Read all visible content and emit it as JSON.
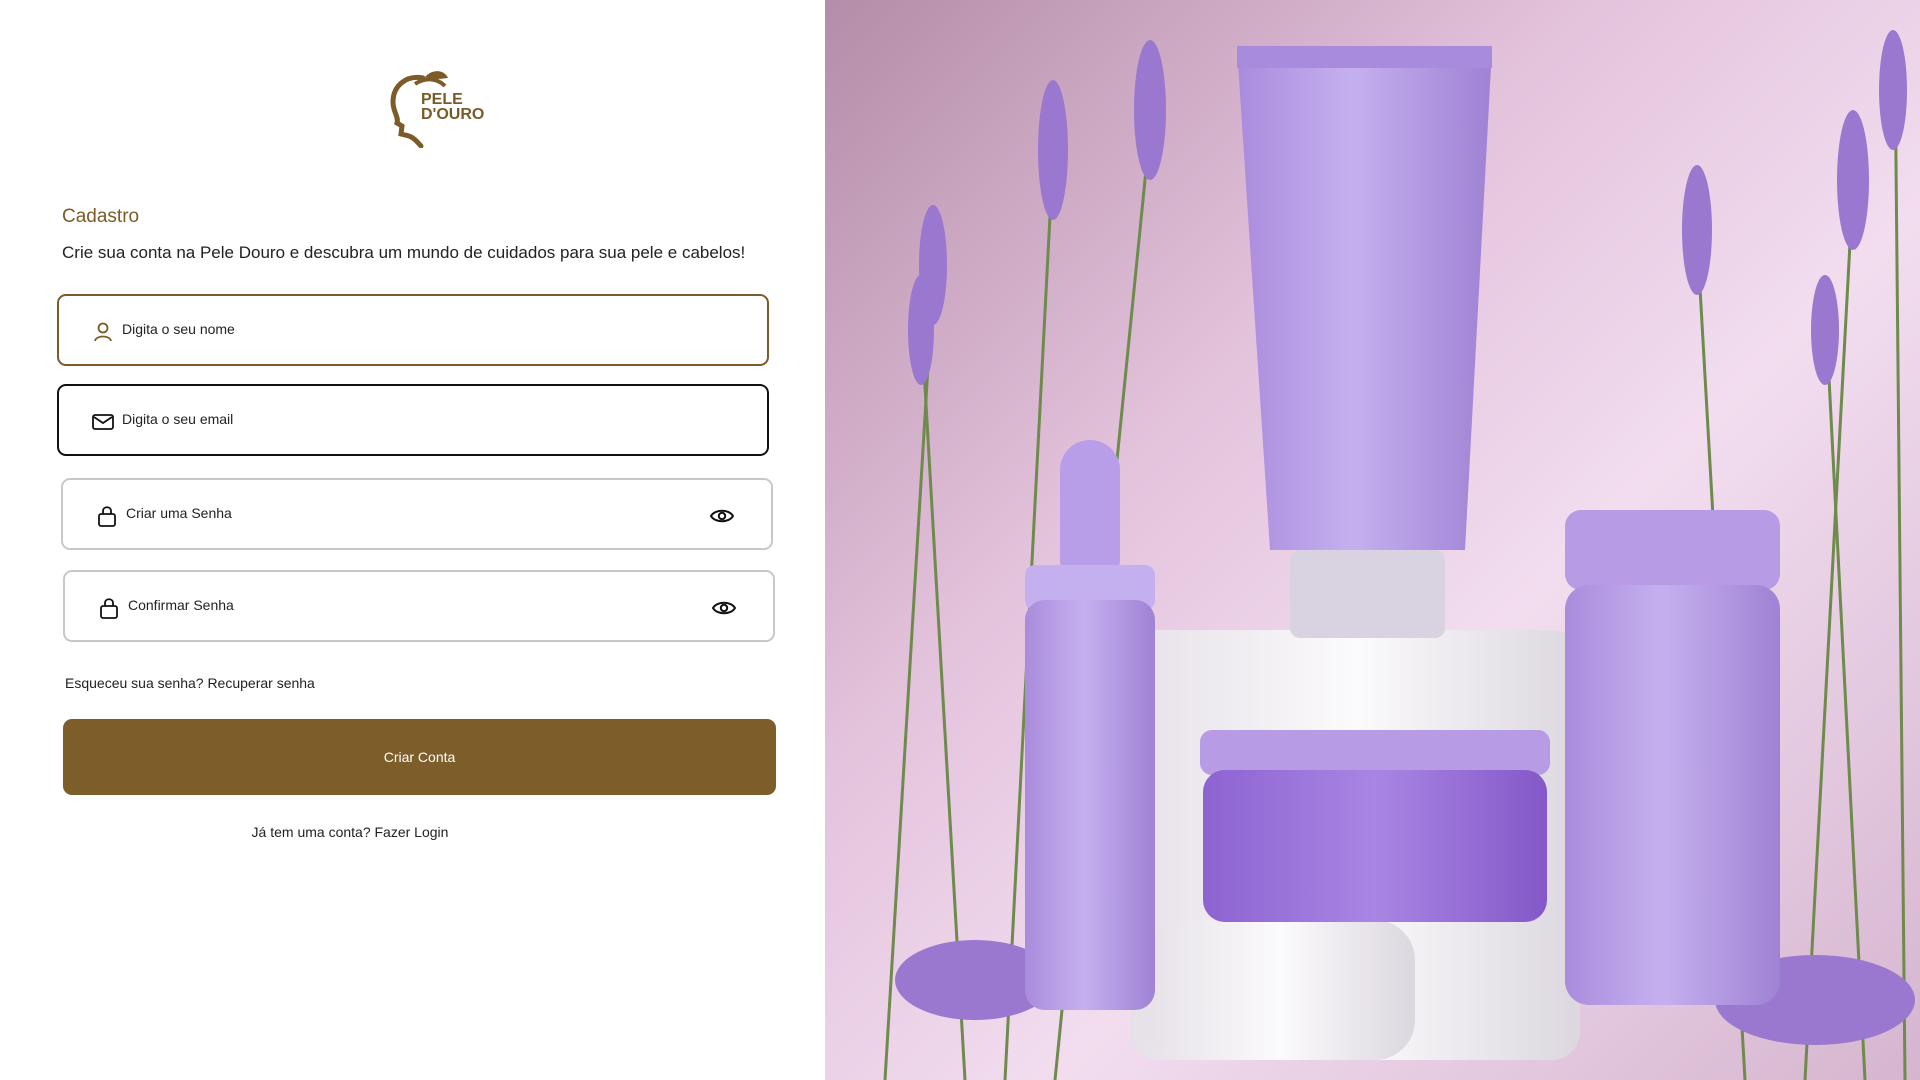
{
  "brand": {
    "line1": "PELE",
    "line2": "D'OURO",
    "color": "#7d5b28"
  },
  "form": {
    "title": "Cadastro",
    "subtitle": "Crie sua conta na Pele Douro e descubra um mundo de cuidados para sua pele e cabelos!",
    "name_placeholder": "Digita o seu nome",
    "email_placeholder": "Digita o seu email",
    "password_placeholder": "Criar uma Senha",
    "confirm_placeholder": "Confirmar Senha",
    "forgot_text": "Esqueceu sua senha? Recuperar senha",
    "submit_label": "Criar Conta",
    "login_text": "Já tem uma conta? Fazer Login"
  },
  "icons": {
    "name": "user-icon",
    "email": "mail-icon",
    "password": "lock-icon",
    "confirm": "lock-icon",
    "toggle": "eye-icon"
  },
  "colors": {
    "accent": "#7d5b28",
    "button": "#7d5d29",
    "lavender": "#b79be4"
  }
}
